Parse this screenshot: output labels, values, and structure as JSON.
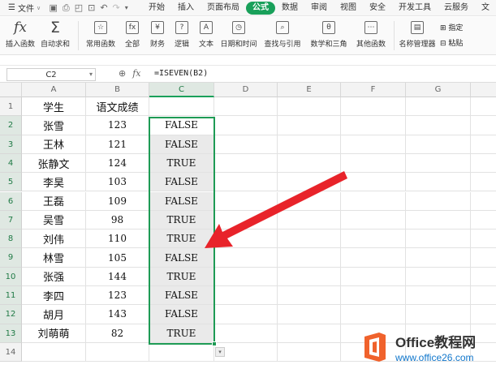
{
  "menu": {
    "file_label": "文件",
    "tabs": [
      {
        "label": "开始",
        "active": false
      },
      {
        "label": "插入",
        "active": false
      },
      {
        "label": "页面布局",
        "active": false
      },
      {
        "label": "公式",
        "active": true
      },
      {
        "label": "数据",
        "active": false
      },
      {
        "label": "审阅",
        "active": false
      },
      {
        "label": "视图",
        "active": false
      },
      {
        "label": "安全",
        "active": false
      },
      {
        "label": "开发工具",
        "active": false
      },
      {
        "label": "云服务",
        "active": false
      },
      {
        "label": "文",
        "active": false
      }
    ]
  },
  "ribbon": {
    "insert_function": "插入函数",
    "autosum": "自动求和",
    "common_functions": "常用函数",
    "all": "全部",
    "finance": "财务",
    "logic": "逻辑",
    "text": "文本",
    "datetime": "日期和时间",
    "lookup": "查找与引用",
    "math": "数学和三角",
    "other": "其他函数",
    "name_manager": "名称管理器",
    "define": "指定",
    "paste": "粘贴"
  },
  "formula_bar": {
    "name_box": "C2",
    "fx": "fx",
    "formula": "=ISEVEN(B2)"
  },
  "columns": [
    "A",
    "B",
    "C",
    "D",
    "E",
    "F",
    "G"
  ],
  "rows": [
    {
      "num": "1",
      "a": "学生",
      "b": "语文成绩",
      "c": ""
    },
    {
      "num": "2",
      "a": "张雪",
      "b": "123",
      "c": "FALSE"
    },
    {
      "num": "3",
      "a": "王林",
      "b": "121",
      "c": "FALSE"
    },
    {
      "num": "4",
      "a": "张静文",
      "b": "124",
      "c": "TRUE"
    },
    {
      "num": "5",
      "a": "李昊",
      "b": "103",
      "c": "FALSE"
    },
    {
      "num": "6",
      "a": "王磊",
      "b": "109",
      "c": "FALSE"
    },
    {
      "num": "7",
      "a": "吴雪",
      "b": "98",
      "c": "TRUE"
    },
    {
      "num": "8",
      "a": "刘伟",
      "b": "110",
      "c": "TRUE"
    },
    {
      "num": "9",
      "a": "林雪",
      "b": "105",
      "c": "FALSE"
    },
    {
      "num": "10",
      "a": "张强",
      "b": "144",
      "c": "TRUE"
    },
    {
      "num": "11",
      "a": "李四",
      "b": "123",
      "c": "FALSE"
    },
    {
      "num": "12",
      "a": "胡月",
      "b": "143",
      "c": "FALSE"
    },
    {
      "num": "13",
      "a": "刘萌萌",
      "b": "82",
      "c": "TRUE"
    },
    {
      "num": "14",
      "a": "",
      "b": "",
      "c": ""
    }
  ],
  "logo": {
    "brand": "Office教程网",
    "url": "www.office26.com"
  },
  "colors": {
    "accent": "#19a05a",
    "arrow": "#e8232a",
    "logo_orange": "#f0622c"
  }
}
